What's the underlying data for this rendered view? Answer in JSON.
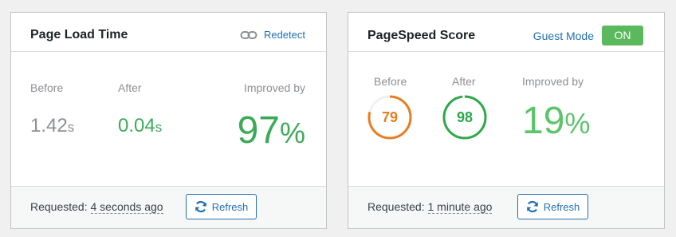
{
  "page_load": {
    "title": "Page Load Time",
    "redetect_label": "Redetect",
    "before_label": "Before",
    "before_value": "1.42",
    "before_unit": "s",
    "after_label": "After",
    "after_value": "0.04",
    "after_unit": "s",
    "improved_label": "Improved by",
    "improved_value": "97",
    "improved_unit": "%",
    "requested_prefix": "Requested:",
    "requested_time": "4 seconds ago",
    "refresh_label": "Refresh"
  },
  "pagespeed": {
    "title": "PageSpeed Score",
    "guest_mode_label": "Guest Mode",
    "toggle_label": "ON",
    "before_label": "Before",
    "before_score": 79,
    "after_label": "After",
    "after_score": 98,
    "improved_label": "Improved by",
    "improved_value": "19",
    "improved_unit": "%",
    "requested_prefix": "Requested:",
    "requested_time": "1 minute ago",
    "refresh_label": "Refresh"
  },
  "colors": {
    "accent": "#2271b1",
    "success": "#3daa5a",
    "toggle": "#5cb85c",
    "score_average": "#e67e22",
    "score_good": "#2ea84a",
    "muted": "#8c8f94"
  },
  "icons": {
    "redetect": "link-icon",
    "refresh": "refresh-icon"
  }
}
